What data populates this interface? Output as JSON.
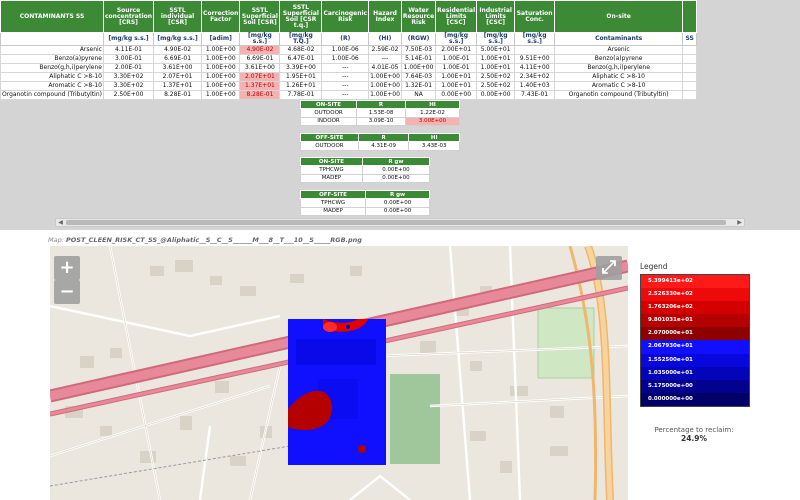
{
  "risk_table": {
    "headers": [
      "CONTAMINANTS SS",
      "Source concentration [CRS]",
      "SSTL individual [CSR]",
      "Correction Factor",
      "SSTL Superficial Soil [CSR]",
      "SSTL Superficial Soil [CSR t.q.]",
      "Carcinogenic Risk",
      "Hazard Index",
      "Water Resource Risk",
      "Residential Limits [CSC]",
      "Industrial Limits [CSC]",
      "Saturation Conc.",
      "On-site"
    ],
    "units": [
      "",
      "[mg/kg s.s.]",
      "[mg/kg s.s.]",
      "[adim]",
      "[mg/kg s.s.]",
      "[mg/kg T.Q.]",
      "(R)",
      "(HI)",
      "(RGW)",
      "[mg/kg s.s.]",
      "[mg/kg s.s.]",
      "[mg/kg s.s.]",
      "Contaminants",
      "SS"
    ],
    "rows": [
      [
        "Arsenic",
        "4.11E-01",
        "4.90E-02",
        "1.00E+00",
        "4.90E-02",
        "4.68E-02",
        "1.00E-06",
        "2.59E-02",
        "7.50E-03",
        "2.00E+01",
        "5.00E+01",
        "",
        "Arsenic"
      ],
      [
        "Benzo(a)pyrene",
        "3.00E-01",
        "6.69E-01",
        "1.00E+00",
        "6.69E-01",
        "6.47E-01",
        "1.00E-06",
        "---",
        "5.14E-01",
        "1.00E-01",
        "1.00E+01",
        "9.51E+00",
        "Benzo(a)pyrene"
      ],
      [
        "Benzo(g,h,i)perylene",
        "2.00E-01",
        "3.61E+00",
        "1.00E+00",
        "3.61E+00",
        "3.39E+00",
        "---",
        "4.01E-05",
        "1.00E+00",
        "1.00E-01",
        "1.00E+01",
        "4.11E+00",
        "Benzo(g,h,i)perylene"
      ],
      [
        "Aliphatic C >8-10",
        "3.30E+02",
        "2.07E+01",
        "1.00E+00",
        "2.07E+01",
        "1.95E+01",
        "---",
        "1.00E+00",
        "7.64E-03",
        "1.00E+01",
        "2.50E+02",
        "2.34E+02",
        "Aliphatic C >8-10"
      ],
      [
        "Aromatic C >8-10",
        "3.30E+02",
        "1.37E+01",
        "1.00E+00",
        "1.37E+01",
        "1.26E+01",
        "---",
        "1.00E+00",
        "1.32E-01",
        "1.00E+01",
        "2.50E+02",
        "1.40E+03",
        "Aromatic C >8-10"
      ],
      [
        "Organotin compound (Tributyltin)",
        "2.50E+00",
        "8.28E-01",
        "1.00E+00",
        "8.28E-01",
        "7.78E-01",
        "---",
        "1.00E+00",
        "NA",
        "0.00E+00",
        "0.00E+00",
        "7.43E-01",
        "Organotin compound (Tributyltin)"
      ]
    ]
  },
  "onsite_summary": {
    "headers": [
      "ON-SITE",
      "R",
      "HI"
    ],
    "rows": [
      [
        "OUTDOOR",
        "1.53E-08",
        "1.22E-02"
      ],
      [
        "INDOOR",
        "3.09E-10",
        "3.00E+00"
      ]
    ]
  },
  "offsite_summary": {
    "headers": [
      "OFF-SITE",
      "R",
      "HI"
    ],
    "rows": [
      [
        "OUTDOOR",
        "4.31E-09",
        "3.43E-03"
      ]
    ]
  },
  "onsite_rgw": {
    "headers": [
      "ON-SITE",
      "R gw"
    ],
    "rows": [
      [
        "TPHCWG",
        "0.00E+00"
      ],
      [
        "MADEP",
        "0.00E+00"
      ]
    ]
  },
  "offsite_rgw": {
    "headers": [
      "OFF-SITE",
      "R gw"
    ],
    "rows": [
      [
        "TPHCWG",
        "0.00E+00"
      ],
      [
        "MADEP",
        "0.00E+00"
      ]
    ]
  },
  "map": {
    "label_prefix": "Map:",
    "filename": "POST_CLEEN_RISK_CT_SS_@Aliphatic__S__C__S______M___8__T___10__S_____RGB.png",
    "zoom_in": "+",
    "zoom_out": "−",
    "fullscreen": "⤢"
  },
  "legend": {
    "title": "Legend",
    "entries": [
      {
        "label": "5.399413e+02",
        "color": "#ff1a1a"
      },
      {
        "label": "2.526330e+02",
        "color": "#ee0a0a"
      },
      {
        "label": "1.763206e+02",
        "color": "#d40000"
      },
      {
        "label": "9.801031e+01",
        "color": "#b40000"
      },
      {
        "label": "2.070000e+01",
        "color": "#8e0000"
      },
      {
        "label": "2.067930e+01",
        "color": "#1010ff"
      },
      {
        "label": "1.552500e+01",
        "color": "#0808dc"
      },
      {
        "label": "1.035000e+01",
        "color": "#0404b8"
      },
      {
        "label": "5.175000e+00",
        "color": "#02028f"
      },
      {
        "label": "0.000000e+00",
        "color": "#000068"
      }
    ]
  },
  "reclaim": {
    "label": "Percentage to reclaim:",
    "value": "24.9%"
  }
}
